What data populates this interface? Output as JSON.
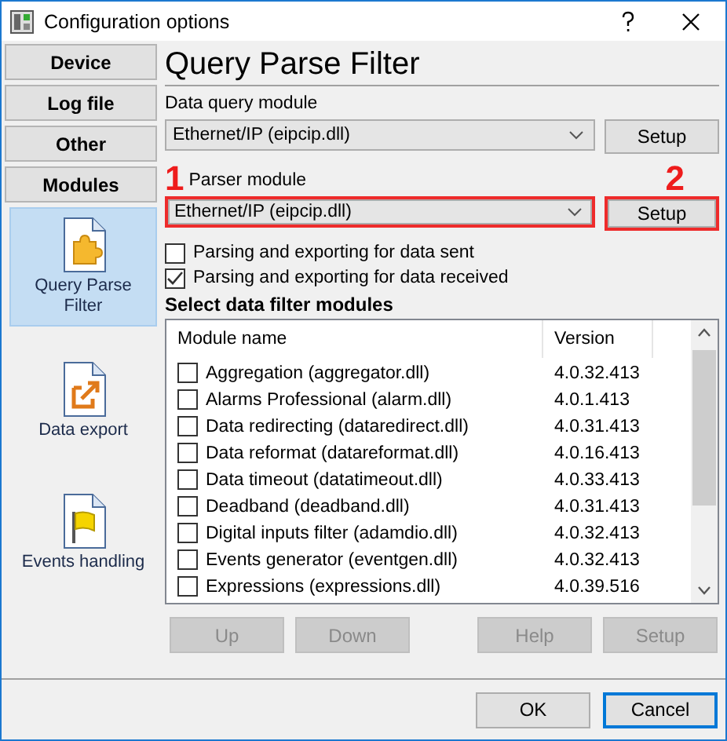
{
  "window": {
    "title": "Configuration options"
  },
  "sidebar": {
    "tabs": [
      {
        "label": "Device"
      },
      {
        "label": "Log file"
      },
      {
        "label": "Other"
      },
      {
        "label": "Modules"
      }
    ],
    "items": [
      {
        "label": "Query Parse Filter",
        "kind": "puzzle",
        "selected": true
      },
      {
        "label": "Data export",
        "kind": "export",
        "selected": false
      },
      {
        "label": "Events handling",
        "kind": "flag",
        "selected": false
      }
    ]
  },
  "page": {
    "title": "Query Parse Filter",
    "query_module": {
      "label": "Data query module",
      "value": "Ethernet/IP (eipcip.dll)",
      "button": "Setup"
    },
    "parser_module": {
      "label": "Parser module",
      "value": "Ethernet/IP (eipcip.dll)",
      "button": "Setup",
      "highlighted": true,
      "marker_combo": "1",
      "marker_button": "2"
    },
    "options": [
      {
        "label": "Parsing and exporting for data sent",
        "checked": false
      },
      {
        "label": "Parsing and exporting for data received",
        "checked": true
      }
    ],
    "filters_heading": "Select data filter modules",
    "table": {
      "columns": [
        "Module name",
        "Version"
      ],
      "rows": [
        {
          "name": "Aggregation (aggregator.dll)",
          "version": "4.0.32.413",
          "checked": false
        },
        {
          "name": "Alarms Professional (alarm.dll)",
          "version": "4.0.1.413",
          "checked": false
        },
        {
          "name": "Data redirecting (dataredirect.dll)",
          "version": "4.0.31.413",
          "checked": false
        },
        {
          "name": "Data reformat (datareformat.dll)",
          "version": "4.0.16.413",
          "checked": false
        },
        {
          "name": "Data timeout (datatimeout.dll)",
          "version": "4.0.33.413",
          "checked": false
        },
        {
          "name": "Deadband (deadband.dll)",
          "version": "4.0.31.413",
          "checked": false
        },
        {
          "name": "Digital inputs filter (adamdio.dll)",
          "version": "4.0.32.413",
          "checked": false
        },
        {
          "name": "Events generator (eventgen.dll)",
          "version": "4.0.32.413",
          "checked": false
        },
        {
          "name": "Expressions (expressions.dll)",
          "version": "4.0.39.516",
          "checked": false
        }
      ]
    },
    "list_buttons": [
      {
        "label": "Up",
        "disabled": true
      },
      {
        "label": "Down",
        "disabled": true
      },
      {
        "label": "Help",
        "disabled": true
      },
      {
        "label": "Setup",
        "disabled": true
      }
    ]
  },
  "footer_buttons": [
    {
      "label": "OK",
      "default": false
    },
    {
      "label": "Cancel",
      "default": true
    }
  ]
}
